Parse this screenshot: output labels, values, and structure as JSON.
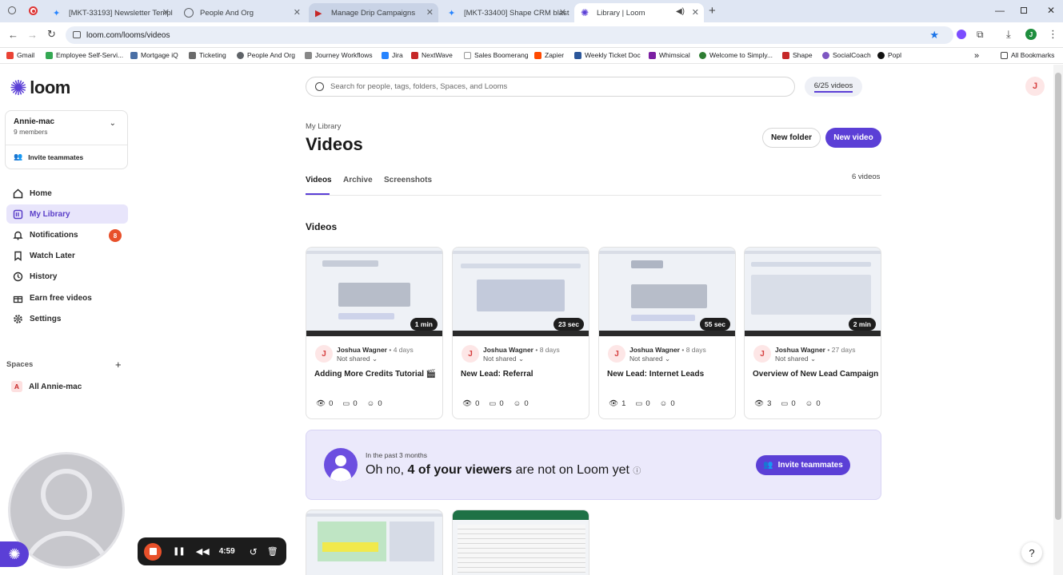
{
  "browser": {
    "tabs": [
      {
        "title": "[MKT-33193] Newsletter Templ",
        "icon": "jira-icon"
      },
      {
        "title": "People And Org",
        "icon": "globe-icon"
      },
      {
        "title": "Manage Drip Campaigns",
        "icon": "play-icon"
      },
      {
        "title": "[MKT-33400] Shape CRM blast",
        "icon": "jira-icon"
      },
      {
        "title": "Library | Loom",
        "icon": "loom-icon"
      }
    ],
    "url": "loom.com/looms/videos",
    "bookmarks": [
      "Gmail",
      "Employee Self-Servi...",
      "Mortgage iQ",
      "Ticketing",
      "People And Org",
      "Journey Workflows",
      "Jira",
      "NextWave",
      "Sales Boomerang",
      "Zapier",
      "Weekly Ticket Doc",
      "Whimsical",
      "Welcome to Simply...",
      "Shape",
      "SocialCoach",
      "Popl"
    ],
    "all_bookmarks": "All Bookmarks",
    "profile_initial": "J"
  },
  "sidebar": {
    "logo": "loom",
    "workspace": {
      "name": "Annie-mac",
      "members": "9 members"
    },
    "invite": "Invite teammates",
    "nav": [
      {
        "label": "Home",
        "icon": "home-icon"
      },
      {
        "label": "My Library",
        "icon": "library-icon"
      },
      {
        "label": "Notifications",
        "icon": "bell-icon",
        "badge": "8"
      },
      {
        "label": "Watch Later",
        "icon": "bookmark-icon"
      },
      {
        "label": "History",
        "icon": "clock-icon"
      },
      {
        "label": "Earn free videos",
        "icon": "gift-icon"
      },
      {
        "label": "Settings",
        "icon": "gear-icon"
      }
    ],
    "spaces_label": "Spaces",
    "space": {
      "initial": "A",
      "name": "All Annie-mac"
    }
  },
  "header": {
    "search_placeholder": "Search for people, tags, folders, Spaces, and Looms",
    "quota": "6/25 videos",
    "avatar": "J"
  },
  "page": {
    "breadcrumb": "My Library",
    "title": "Videos",
    "new_folder": "New folder",
    "new_video": "New video",
    "tabs": [
      "Videos",
      "Archive",
      "Screenshots"
    ],
    "count": "6 videos",
    "section": "Videos"
  },
  "videos": [
    {
      "duration": "1 min",
      "author": "Joshua Wagner",
      "age": "4 days",
      "share": "Not shared",
      "title": "Adding More Credits Tutorial 🎬",
      "views": "0",
      "comments": "0",
      "reactions": "0",
      "initial": "J"
    },
    {
      "duration": "23 sec",
      "author": "Joshua Wagner",
      "age": "8 days",
      "share": "Not shared",
      "title": "New Lead: Referral",
      "views": "0",
      "comments": "0",
      "reactions": "0",
      "initial": "J"
    },
    {
      "duration": "55 sec",
      "author": "Joshua Wagner",
      "age": "8 days",
      "share": "Not shared",
      "title": "New Lead: Internet Leads",
      "views": "1",
      "comments": "0",
      "reactions": "0",
      "initial": "J"
    },
    {
      "duration": "2 min",
      "author": "Joshua Wagner",
      "age": "27 days",
      "share": "Not shared",
      "title": "Overview of New Lead Campaign",
      "views": "3",
      "comments": "0",
      "reactions": "0",
      "initial": "J"
    }
  ],
  "banner": {
    "sub": "In the past 3 months",
    "pre": "Oh no, ",
    "bold": "4 of your viewers",
    "post": " are not on Loom yet",
    "button": "Invite teammates"
  },
  "recorder": {
    "time": "4:59"
  },
  "help": "?",
  "colors": {
    "accent": "#5b3fd6",
    "badge": "#e8502a",
    "banner_bg": "#ebe9fb"
  }
}
